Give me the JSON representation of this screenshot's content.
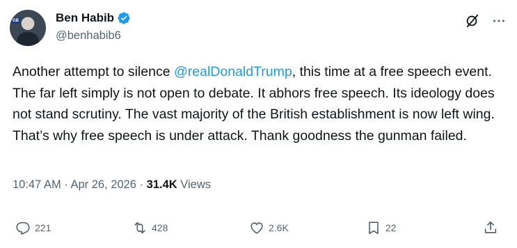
{
  "author": {
    "name": "Ben Habib",
    "handle": "@benhabib6",
    "avatar_badge": "GB"
  },
  "tweet": {
    "text_prefix": "Another attempt to silence ",
    "mention": "@realDonaldTrump",
    "text_rest": ", this time at a free speech event.  The far left simply is not open to debate. It abhors free speech. Its ideology does not stand scrutiny.  The vast majority of the British establishment is now left wing. That’s why free speech is under attack.  Thank goodness the gunman failed."
  },
  "meta": {
    "time": "10:47 AM",
    "date": "Apr 26, 2026",
    "views_count": "31.4K",
    "views_label": "Views"
  },
  "actions": {
    "replies": "221",
    "reposts": "428",
    "likes": "2.6K",
    "bookmarks": "22"
  },
  "colors": {
    "accent": "#1d9bf0",
    "text": "#0f1419",
    "secondary": "#536471"
  }
}
